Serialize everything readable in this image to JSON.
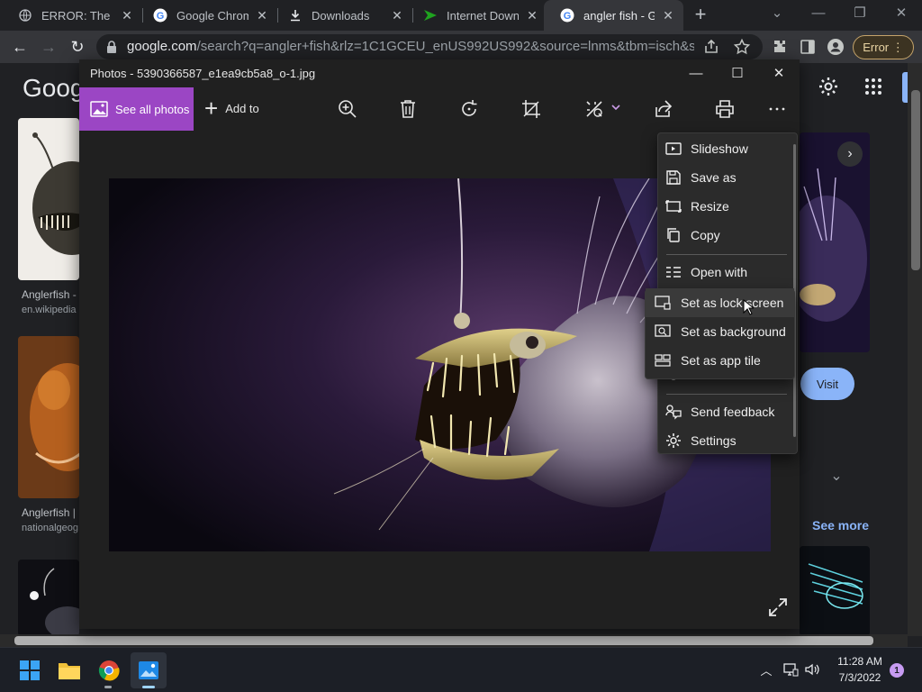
{
  "browser": {
    "tabs": [
      {
        "title": "ERROR: The requ",
        "icon": "globe-icon"
      },
      {
        "title": "Google Chrome",
        "icon": "google-icon"
      },
      {
        "title": "Downloads",
        "icon": "download-icon"
      },
      {
        "title": "Internet Downlo",
        "icon": "idm-icon"
      },
      {
        "title": "angler fish - Go",
        "icon": "google-icon"
      }
    ],
    "url_host": "google.com",
    "url_rest": "/search?q=angler+fish&rlz=1C1GCEU_enUS992US992&source=lnms&tbm=isch&sa=X&...",
    "error_badge": "Error"
  },
  "google": {
    "logo": "Goog",
    "results": [
      {
        "caption": "Anglerfish -",
        "source": "en.wikipedia"
      },
      {
        "caption": "Anglerfish |",
        "source": "nationalgeog"
      }
    ],
    "visit_label": "Visit",
    "see_more_label": "See more"
  },
  "photos": {
    "title": "Photos - 5390366587_e1ea9cb5a8_o-1.jpg",
    "see_all_label": "See all photos",
    "add_to_label": "Add to",
    "menu": {
      "items": [
        "Slideshow",
        "Save as",
        "Resize",
        "Copy",
        "Open with",
        "Send feedback",
        "Settings"
      ]
    },
    "submenu": {
      "items": [
        "Set as lock screen",
        "Set as background",
        "Set as app tile"
      ]
    }
  },
  "taskbar": {
    "time": "11:28 AM",
    "date": "7/3/2022",
    "notifications": "1"
  },
  "colors": {
    "photos_accent": "#9b46c4",
    "google_blue": "#8ab4f8",
    "error_amber": "#c5a46a"
  }
}
